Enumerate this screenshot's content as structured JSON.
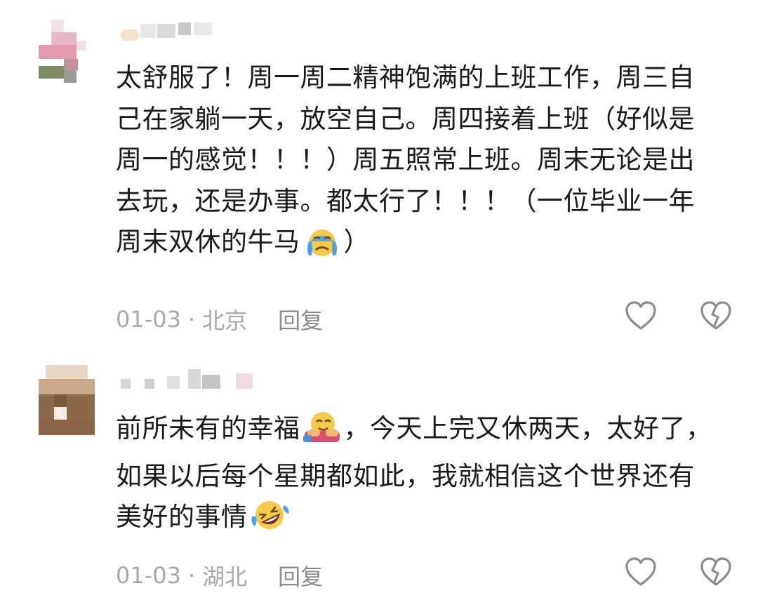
{
  "comments": [
    {
      "lines": [
        "太舒服了！周一周二精神饱满的上班工作，周三自",
        "己在家躺一天，放空自己。周四接着上班（好似是",
        "周一的感觉！！！）周五照常上班。周末无论是出",
        "去玩，还是办事。都太行了！！！（一位毕业一年",
        "周末双休的牛马"
      ],
      "tail": "）",
      "emoji": "crying-face",
      "date": "01-03",
      "location": "北京",
      "reply_label": "回复"
    },
    {
      "line1_a": "前所未有的幸福",
      "line1_b": "，今天上完又休两天，太好了，",
      "line2": "如果以后每个星期都如此，我就相信这个世界还有",
      "line3": "美好的事情",
      "emoji1": "self-hug-emoji",
      "emoji2": "rolling-laughing-emoji",
      "date": "01-03",
      "location": "湖北",
      "reply_label": "回复"
    }
  ],
  "colors": {
    "text": "#1a1a1a",
    "meta": "#a8a8a8",
    "icon": "#8c8c8c"
  }
}
